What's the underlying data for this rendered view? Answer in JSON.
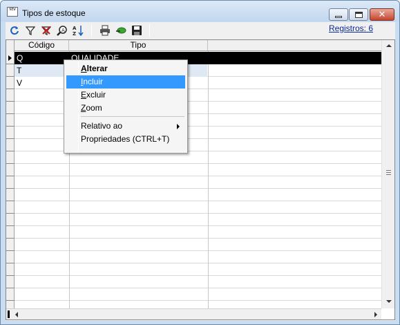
{
  "window": {
    "title": "Tipos de estoque",
    "app_icon_text": "NEW"
  },
  "toolbar": {
    "registros_label": "Registros: 6",
    "buttons": [
      "refresh-icon",
      "filter-icon",
      "clear-filter-icon",
      "search-icon",
      "sort-icon",
      "print-icon",
      "export-icon",
      "save-icon"
    ]
  },
  "grid": {
    "columns": [
      "Código",
      "Tipo"
    ],
    "rows": [
      {
        "codigo": "Q",
        "tipo": "QUALIDADE"
      },
      {
        "codigo": "T",
        "tipo": ""
      },
      {
        "codigo": "V",
        "tipo": ""
      }
    ]
  },
  "context_menu": {
    "items": [
      {
        "first": "A",
        "rest": "lterar"
      },
      {
        "first": "I",
        "rest": "ncluir"
      },
      {
        "first": "E",
        "rest": "xcluir"
      },
      {
        "first": "Z",
        "rest": "oom"
      },
      {
        "label": "Relativo ao"
      },
      {
        "label": "Propriedades (CTRL+T)"
      }
    ]
  },
  "colors": {
    "menu_highlight": "#3399ff",
    "selected_row": "#000000",
    "alt_row": "#dfe9f5",
    "link": "#0b2a9a"
  }
}
